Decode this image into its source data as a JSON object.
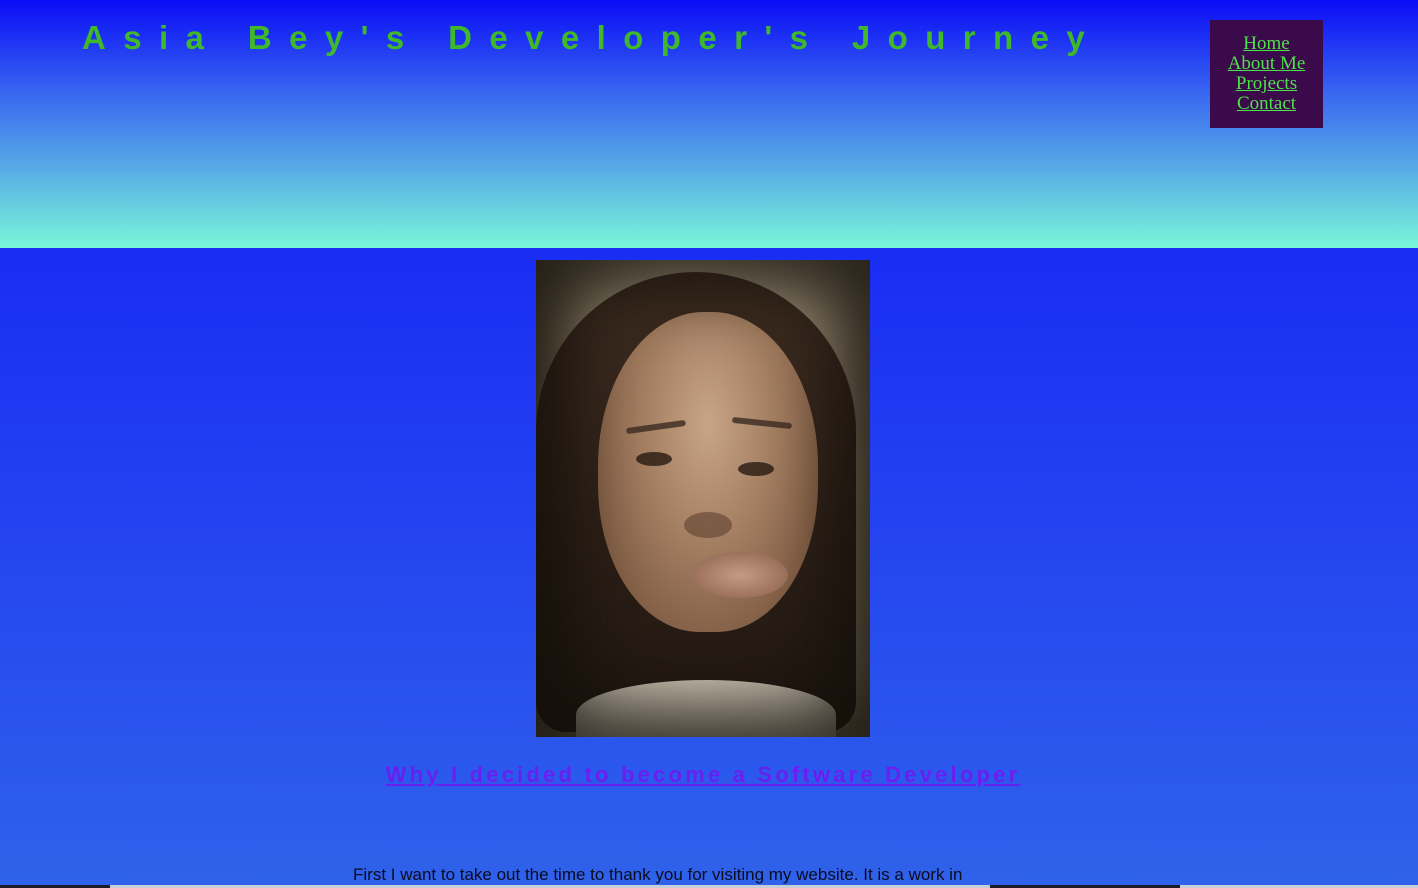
{
  "header": {
    "title": "Asia Bey's Developer's Journey"
  },
  "nav": {
    "items": [
      {
        "label": "Home"
      },
      {
        "label": "About Me"
      },
      {
        "label": "Projects"
      },
      {
        "label": "Contact"
      }
    ]
  },
  "main": {
    "photo_alt": "Profile photo",
    "section_heading": "Why I decided to become a Software Developer",
    "intro_text": "First I want to take out the time to thank you for visiting my website. It is a work in"
  },
  "colors": {
    "title": "#3fb92a",
    "nav_background": "#3b0a4a",
    "nav_link": "#4ee24a",
    "heading_link": "#6a1ef0",
    "header_gradient_top": "#0a0cf6",
    "header_gradient_bottom": "#78f6d8",
    "page_background": "#1f39f2"
  }
}
